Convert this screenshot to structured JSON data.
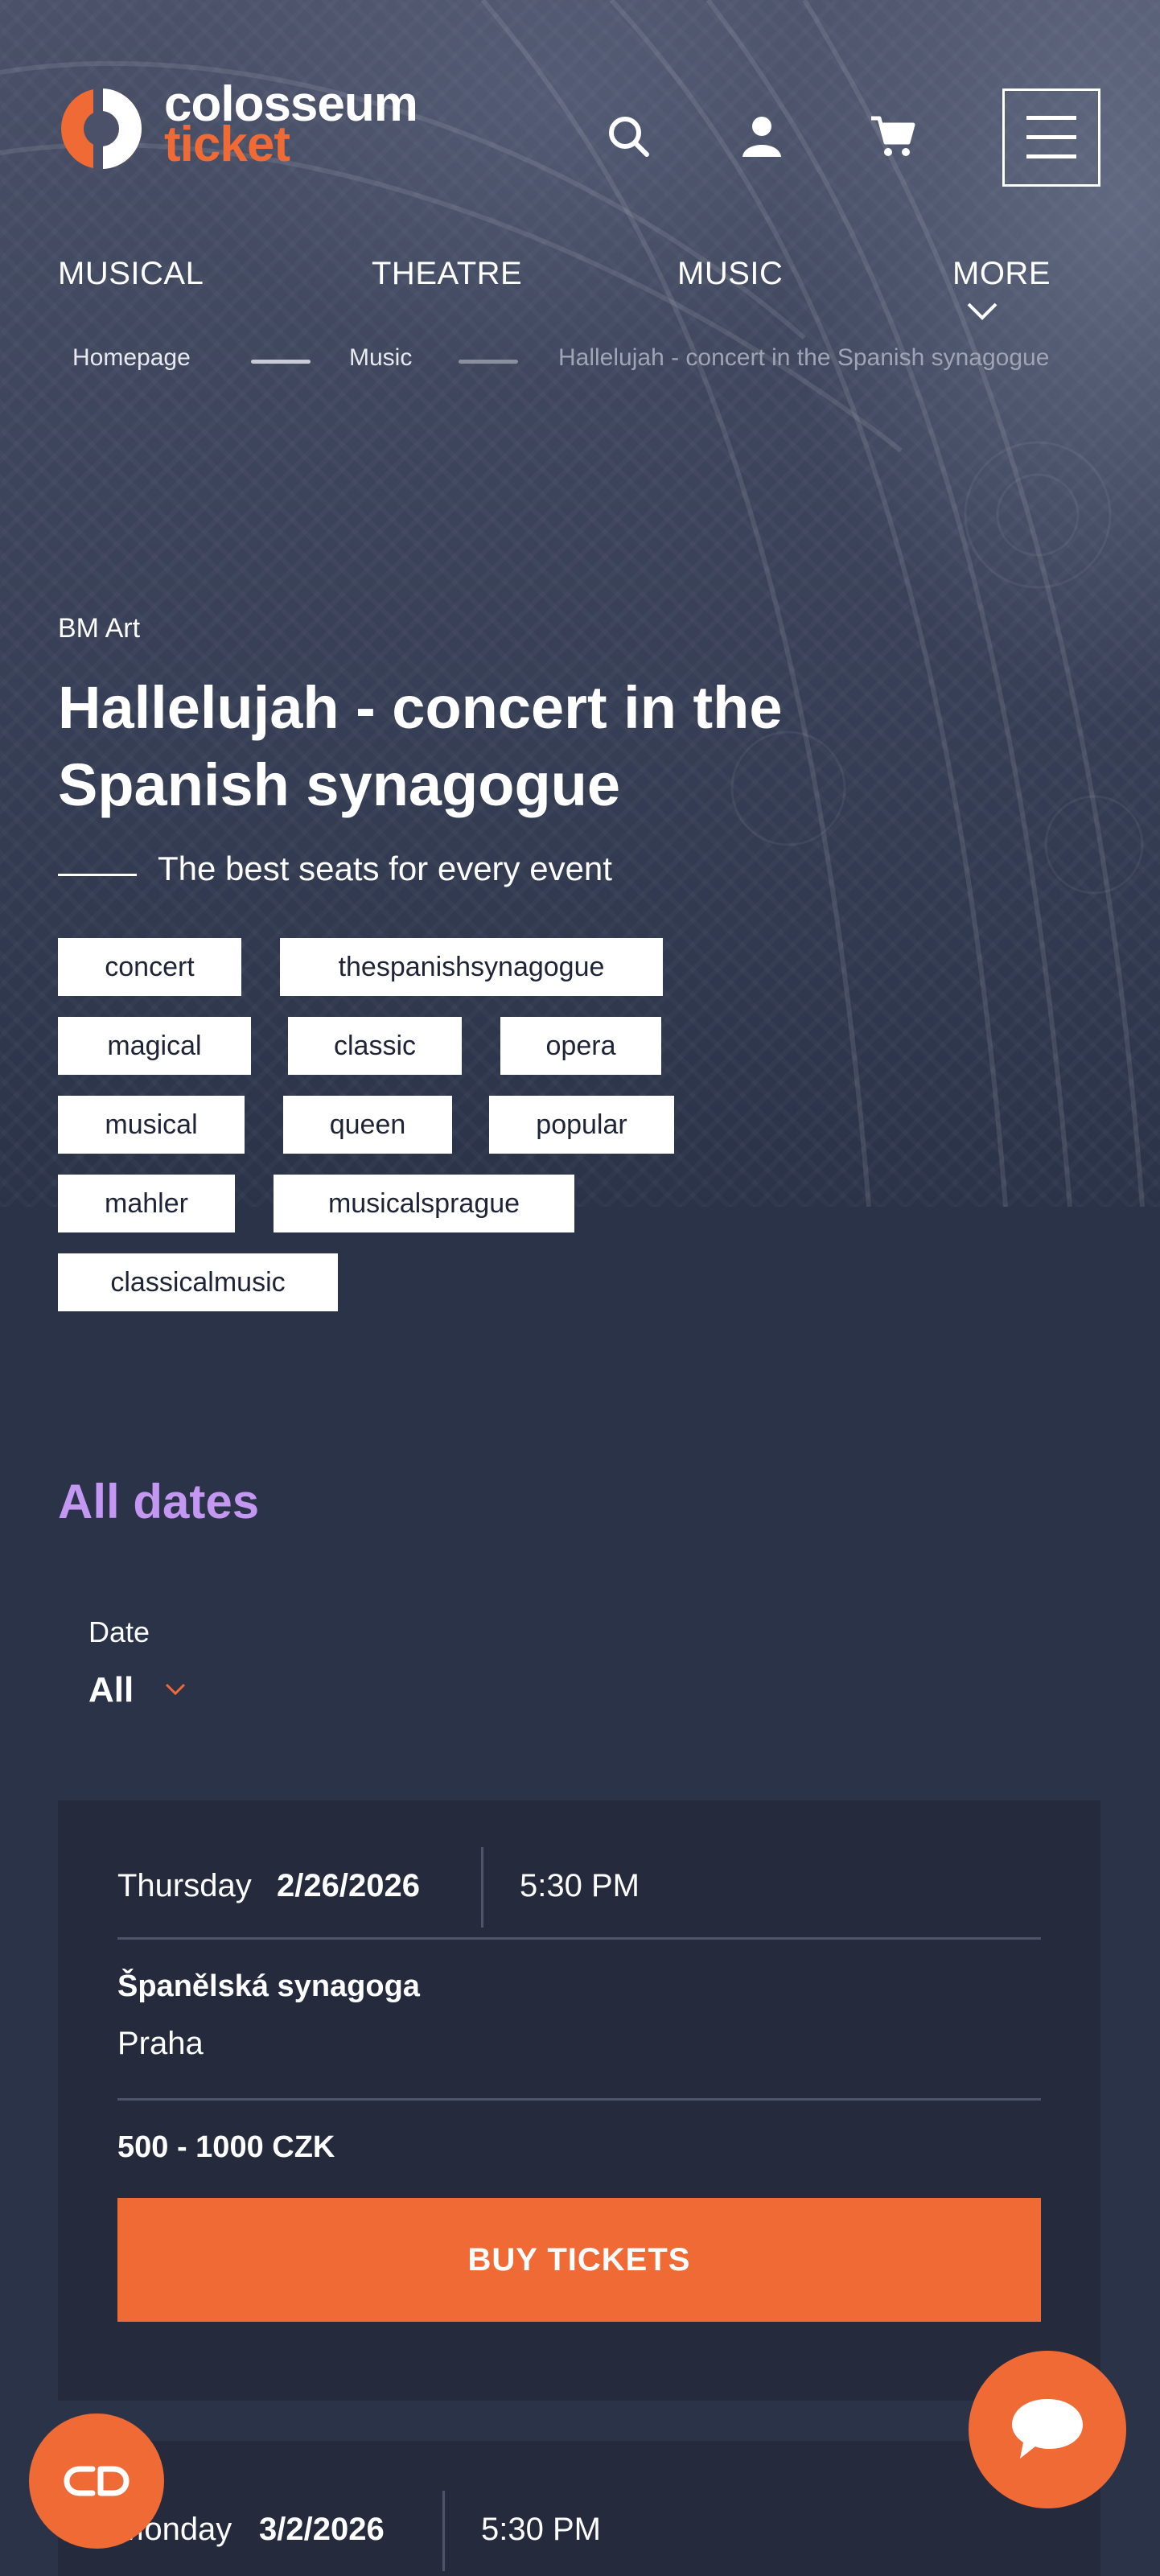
{
  "brand": {
    "line1": "colosseum",
    "line2": "ticket",
    "accent": "#f06a35"
  },
  "header_icons": {
    "search": "search-icon",
    "account": "user-icon",
    "cart": "cart-icon",
    "menu": "hamburger-icon"
  },
  "nav": {
    "items": [
      {
        "label": "MUSICAL"
      },
      {
        "label": "THEATRE"
      },
      {
        "label": "MUSIC"
      },
      {
        "label": "MORE"
      }
    ]
  },
  "breadcrumb": {
    "home": "Homepage",
    "section": "Music",
    "current": "Hallelujah - concert in the Spanish synagogue"
  },
  "event": {
    "organizer": "BM Art",
    "title_line1": "Hallelujah - concert in the",
    "title_line2": "Spanish synagogue",
    "tagline": "The best seats for every event",
    "tags": [
      "concert",
      "thespanishsynagogue",
      "magical",
      "classic",
      "opera",
      "musical",
      "queen",
      "popular",
      "mahler",
      "musicalsprague",
      "classicalmusic"
    ]
  },
  "dates_section": {
    "heading": "All dates",
    "heading_color": "#c497f2",
    "filter_label": "Date",
    "filter_value": "All"
  },
  "performances": [
    {
      "weekday": "Thursday",
      "date": "2/26/2026",
      "time": "5:30 PM",
      "venue": "Španělská synagoga",
      "city": "Praha",
      "price": "500 - 1000 CZK",
      "button": "BUY TICKETS"
    },
    {
      "weekday": "Monday",
      "date": "3/2/2026",
      "time": "5:30 PM"
    }
  ]
}
